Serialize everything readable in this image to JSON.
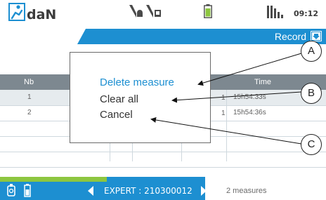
{
  "app": {
    "name": "daN",
    "clock": "09:12"
  },
  "status_icons": [
    "alarm-bell-icon",
    "signal-sim-icon",
    "battery-icon",
    "signal-bars-icon"
  ],
  "record": {
    "label": "Record",
    "icon": "download-icon"
  },
  "table": {
    "headers": {
      "nb": "Nb",
      "time": "Time"
    },
    "rows": [
      {
        "nb": "1",
        "time": "15h54:33s"
      },
      {
        "nb": "2",
        "time": "15h54:36s"
      }
    ]
  },
  "popup": {
    "items": [
      "Delete measure",
      "Clear all",
      "Cancel"
    ],
    "selected_index": 0
  },
  "callouts": [
    "A",
    "B",
    "C"
  ],
  "bottom": {
    "expert": "EXPERT : 210300012",
    "count": "2 measures"
  },
  "colors": {
    "accent": "#1d8fd1",
    "green": "#8dc63f",
    "header": "#7d8890"
  }
}
